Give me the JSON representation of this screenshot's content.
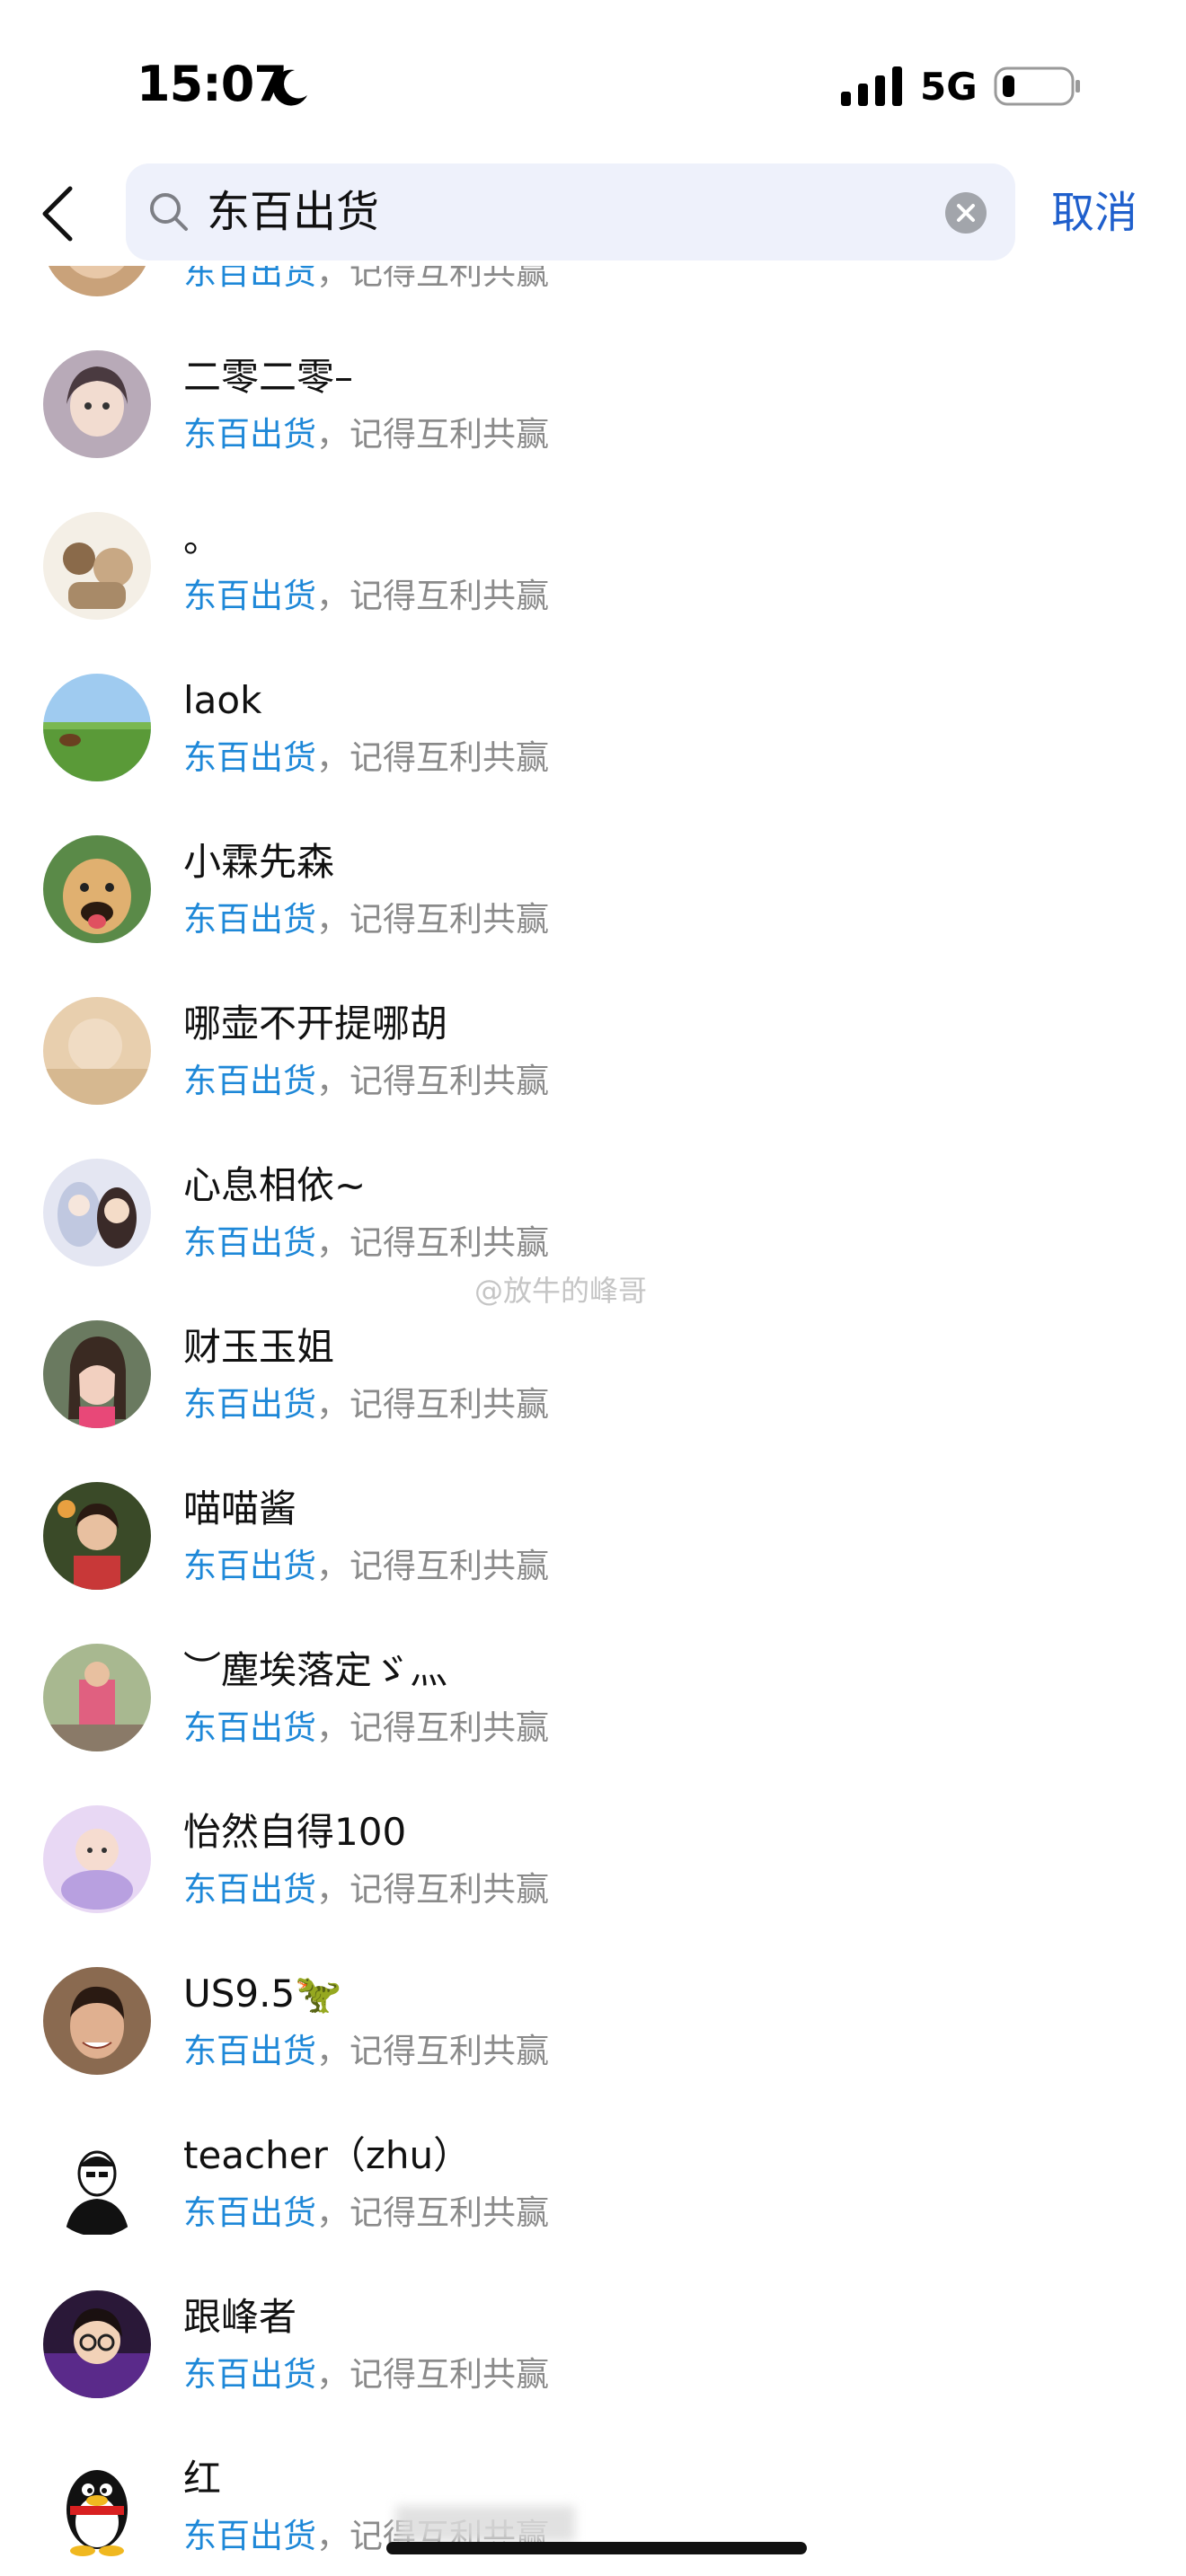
{
  "status_bar": {
    "time": "15:07",
    "network": "5G",
    "icons": [
      "moon-icon",
      "signal-icon",
      "battery-icon"
    ]
  },
  "search": {
    "query": "东百出货",
    "cancel_label": "取消",
    "icons": [
      "back-icon",
      "search-icon",
      "clear-icon"
    ]
  },
  "colors": {
    "highlight": "#1e88d8",
    "cancel": "#1f5fcc",
    "search_bg": "#eef1fb",
    "secondary_text": "#8a8a8a"
  },
  "results": [
    {
      "name": "",
      "snippet_highlight": "东百出货",
      "snippet_rest": "，记得互利共赢"
    },
    {
      "name": "二零二零–",
      "snippet_highlight": "东百出货",
      "snippet_rest": "，记得互利共赢"
    },
    {
      "name": "。",
      "snippet_highlight": "东百出货",
      "snippet_rest": "，记得互利共赢"
    },
    {
      "name": "laok",
      "snippet_highlight": "东百出货",
      "snippet_rest": "，记得互利共赢"
    },
    {
      "name": "小霖先森",
      "snippet_highlight": "东百出货",
      "snippet_rest": "，记得互利共赢"
    },
    {
      "name": "哪壶不开提哪胡",
      "snippet_highlight": "东百出货",
      "snippet_rest": "，记得互利共赢"
    },
    {
      "name": "心息相依~",
      "snippet_highlight": "东百出货",
      "snippet_rest": "，记得互利共赢"
    },
    {
      "name": "财玉玉姐",
      "snippet_highlight": "东百出货",
      "snippet_rest": "，记得互利共赢"
    },
    {
      "name": "喵喵酱",
      "snippet_highlight": "东百出货",
      "snippet_rest": "，记得互利共赢"
    },
    {
      "name": "︶塵埃落定ゞ灬",
      "snippet_highlight": "东百出货",
      "snippet_rest": "，记得互利共赢"
    },
    {
      "name": "怡然自得100",
      "snippet_highlight": "东百出货",
      "snippet_rest": "，记得互利共赢"
    },
    {
      "name": "US9.5🦖",
      "snippet_highlight": "东百出货",
      "snippet_rest": "，记得互利共赢"
    },
    {
      "name": "teacher（zhu）",
      "snippet_highlight": "东百出货",
      "snippet_rest": "，记得互利共赢"
    },
    {
      "name": "跟峰者",
      "snippet_highlight": "东百出货",
      "snippet_rest": "，记得互利共赢"
    },
    {
      "name": "红",
      "snippet_highlight": "东百出货",
      "snippet_rest": "，记得互利共赢"
    }
  ],
  "watermark": "@放牛的峰哥"
}
